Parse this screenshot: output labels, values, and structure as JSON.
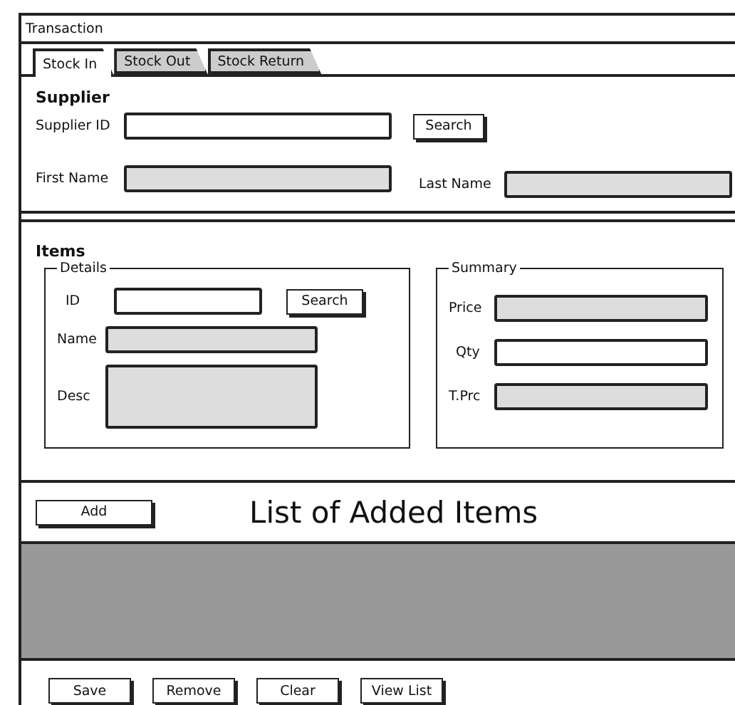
{
  "window": {
    "title": "Transaction"
  },
  "tabs": [
    {
      "label": "Stock In",
      "selected": true
    },
    {
      "label": "Stock Out",
      "selected": false
    },
    {
      "label": "Stock Return",
      "selected": false
    }
  ],
  "supplier": {
    "heading": "Supplier",
    "search_button": "Search",
    "fields": [
      {
        "label": "Supplier ID",
        "disabled": false
      },
      {
        "label": "First Name",
        "disabled": true
      },
      {
        "label": "Last Name",
        "disabled": true
      }
    ]
  },
  "items": {
    "heading": "Items",
    "details": {
      "legend": "Details",
      "search_button": "Search",
      "fields": [
        {
          "label": "ID",
          "disabled": false,
          "kind": "input"
        },
        {
          "label": "Name",
          "disabled": true,
          "kind": "input"
        },
        {
          "label": "Desc",
          "disabled": true,
          "kind": "textarea"
        }
      ]
    },
    "summary": {
      "legend": "Summary",
      "fields": [
        {
          "label": "Price",
          "disabled": true
        },
        {
          "label": "Qty",
          "disabled": false
        },
        {
          "label": "T.Prc",
          "disabled": true
        }
      ]
    }
  },
  "add_button": "Add",
  "list_title": "List of Added Items",
  "buttons": [
    "Save",
    "Remove",
    "Clear",
    "View List"
  ]
}
